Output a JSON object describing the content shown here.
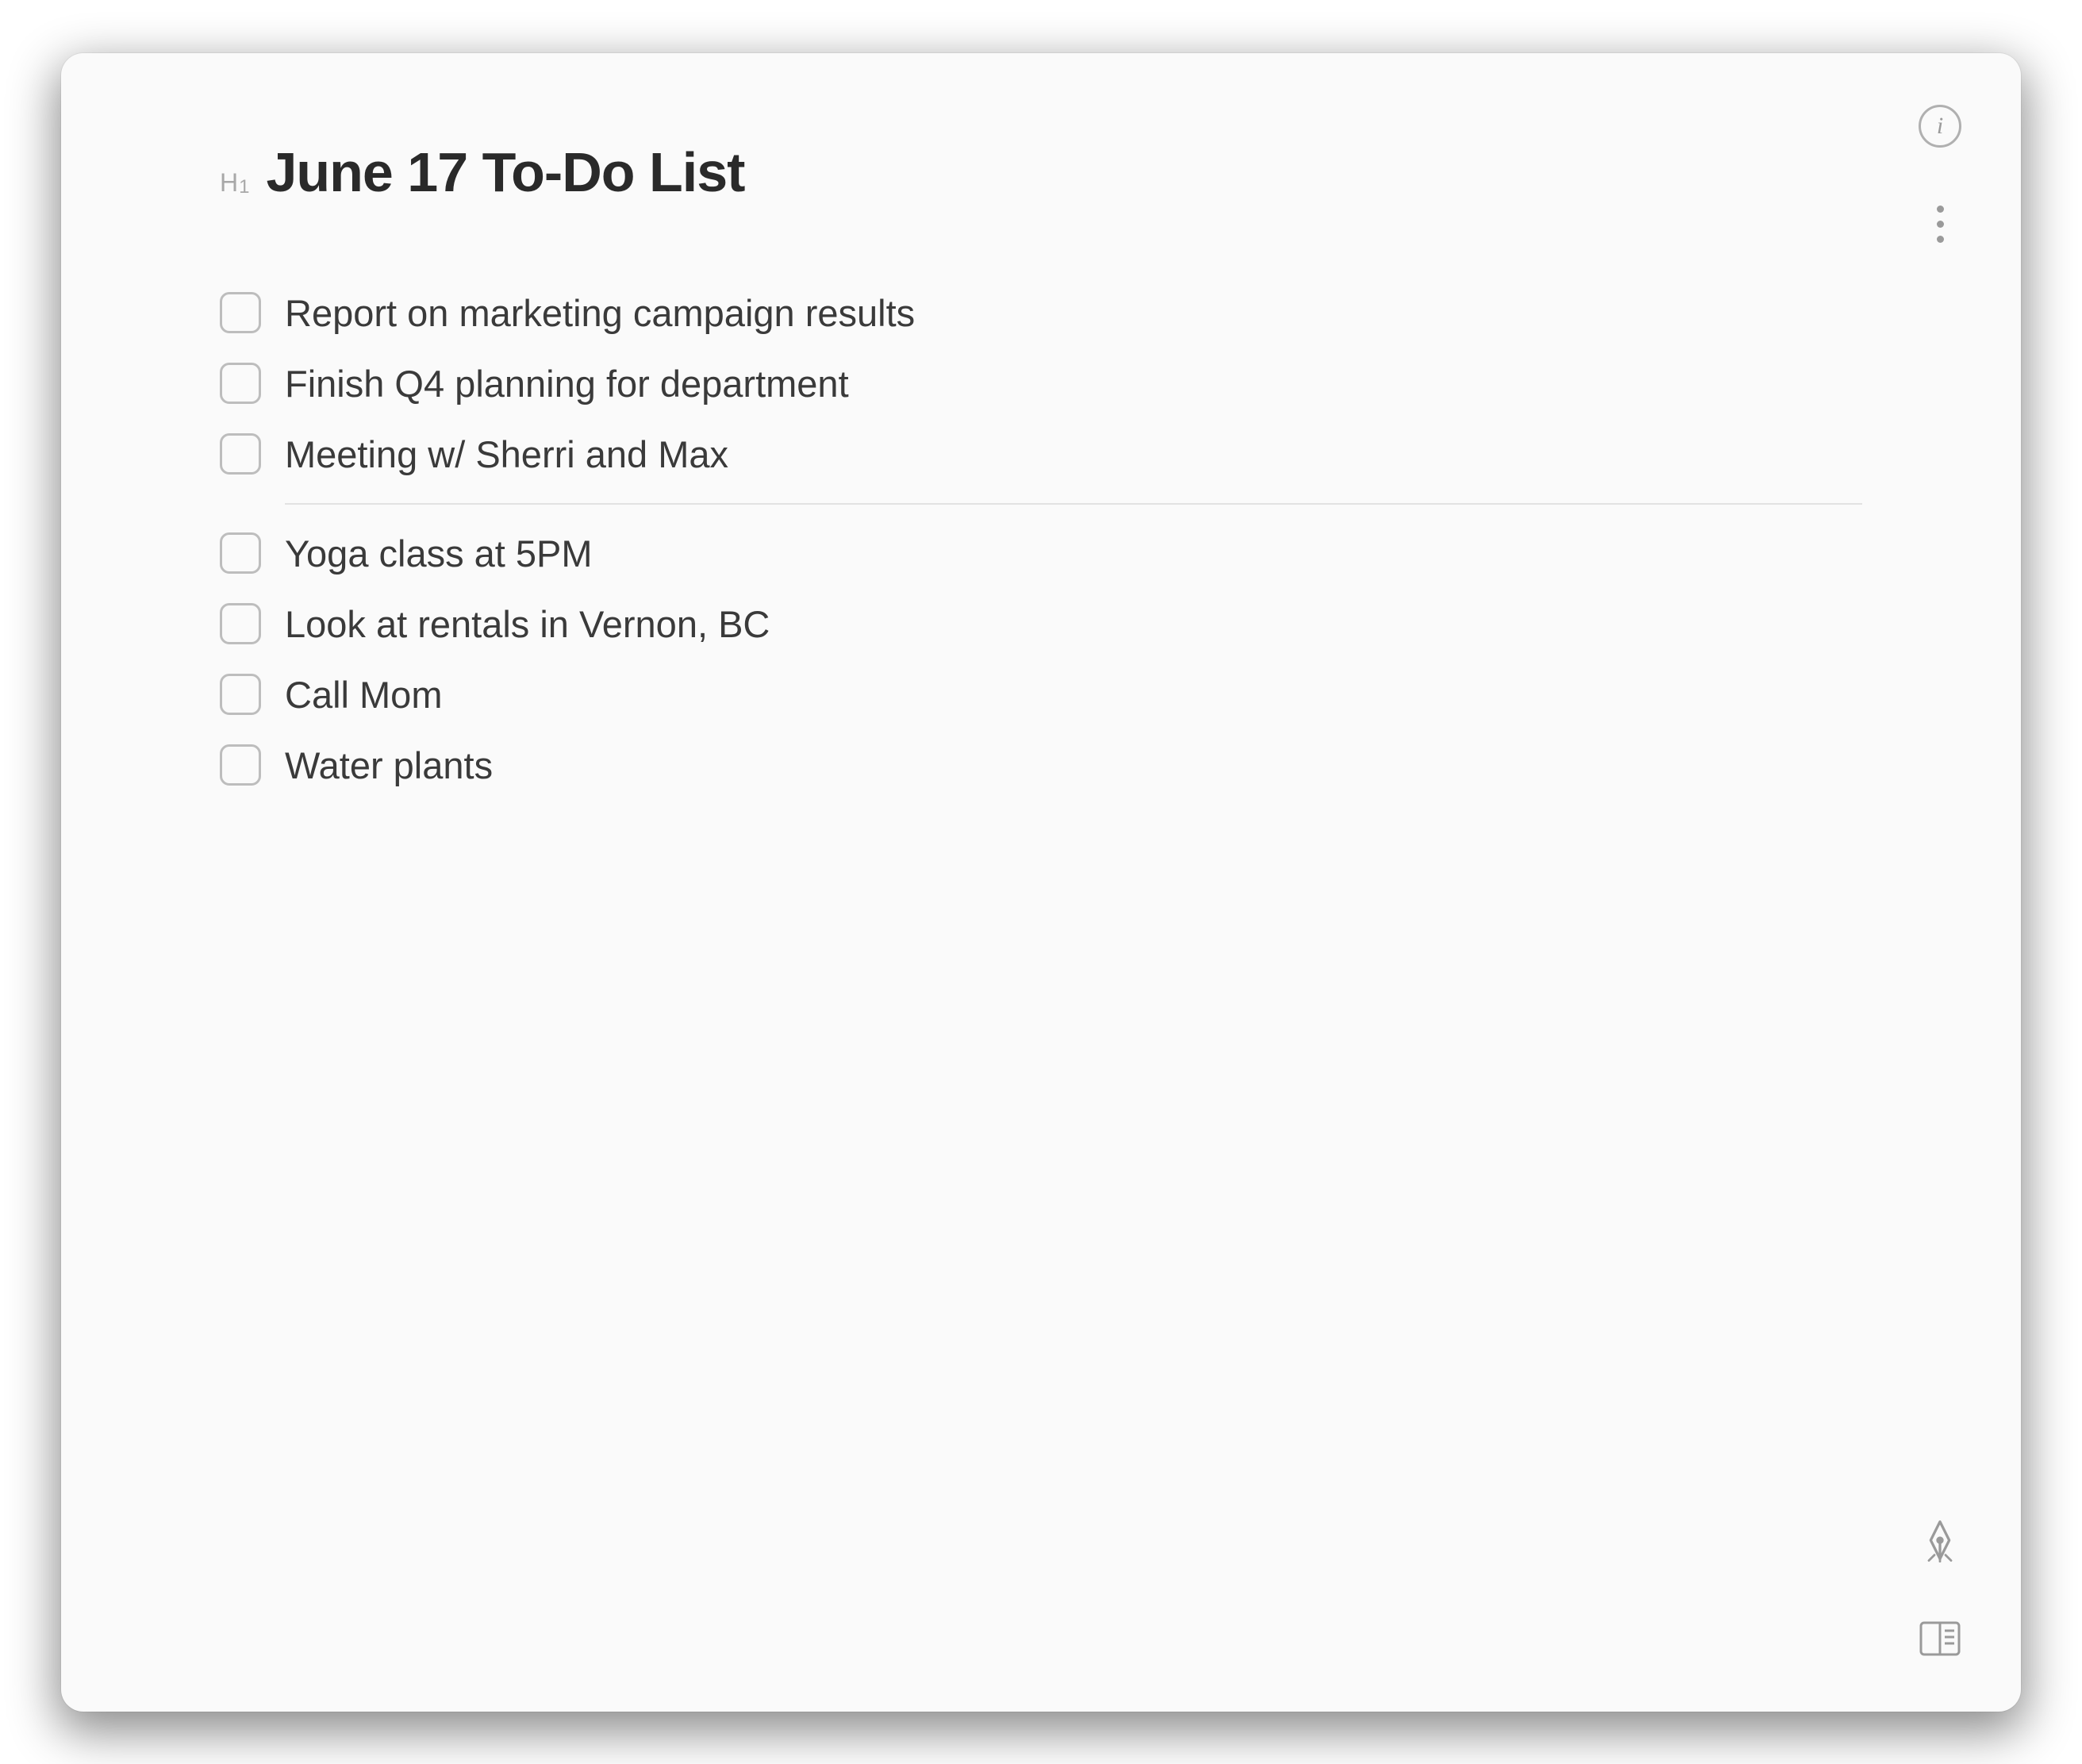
{
  "heading": {
    "badge": "H1",
    "title": "June 17 To-Do List"
  },
  "groups": [
    {
      "items": [
        {
          "label": "Report on marketing campaign results",
          "checked": false
        },
        {
          "label": "Finish Q4 planning for department",
          "checked": false
        },
        {
          "label": "Meeting w/ Sherri and Max",
          "checked": false
        }
      ]
    },
    {
      "items": [
        {
          "label": "Yoga class at 5PM",
          "checked": false
        },
        {
          "label": "Look at rentals in Vernon, BC",
          "checked": false
        },
        {
          "label": "Call Mom",
          "checked": false
        },
        {
          "label": "Water plants",
          "checked": false
        }
      ]
    }
  ]
}
